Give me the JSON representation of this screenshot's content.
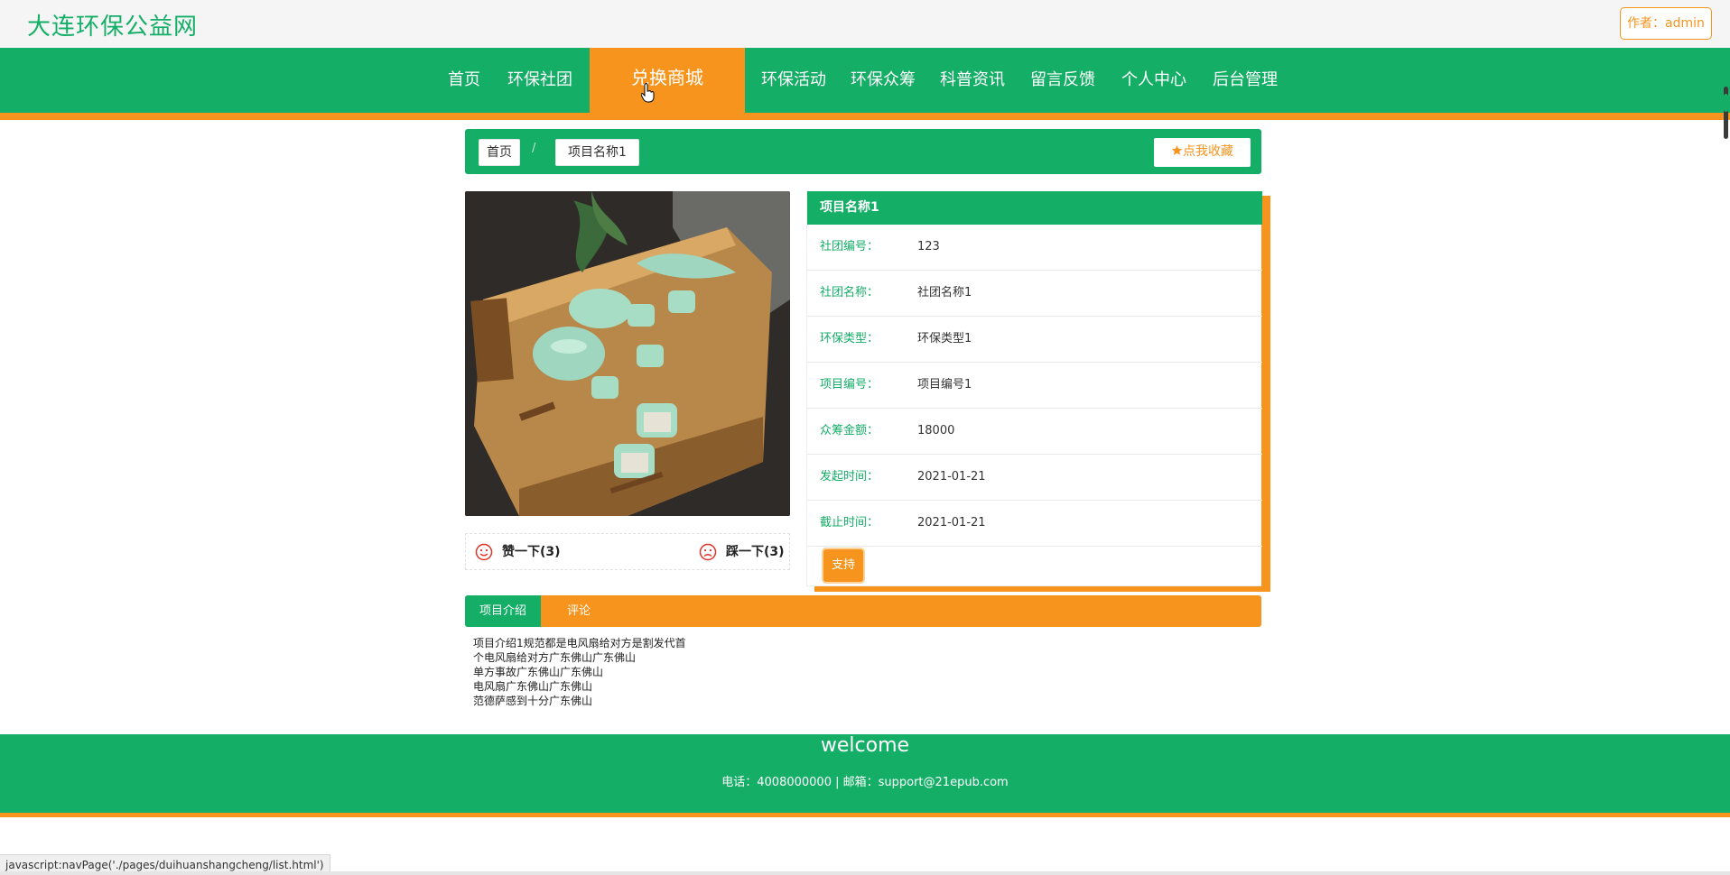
{
  "header": {
    "site_title": "大连环保公益网",
    "author_label": "作者：admin"
  },
  "nav": {
    "items": [
      "首页",
      "环保社团",
      "兑换商城",
      "环保活动",
      "环保众筹",
      "科普资讯",
      "留言反馈",
      "个人中心",
      "后台管理"
    ],
    "active": "兑换商城"
  },
  "breadcrumb": {
    "home": "首页",
    "separator": "/",
    "current": "项目名称1",
    "favorite_label": "点我收藏"
  },
  "votes": {
    "like_label": "赞一下(3)",
    "dislike_label": "踩一下(3)"
  },
  "detail": {
    "title": "项目名称1",
    "fields": [
      {
        "label": "社团编号：",
        "value": "123"
      },
      {
        "label": "社团名称：",
        "value": "社团名称1"
      },
      {
        "label": "环保类型：",
        "value": "环保类型1"
      },
      {
        "label": "项目编号：",
        "value": "项目编号1"
      },
      {
        "label": "众筹金额：",
        "value": "18000"
      },
      {
        "label": "发起时间：",
        "value": "2021-01-21"
      },
      {
        "label": "截止时间：",
        "value": "2021-01-21"
      }
    ],
    "support_label": "支持"
  },
  "tabs": {
    "items": [
      "项目介绍",
      "评论"
    ],
    "active": "项目介绍"
  },
  "intro": {
    "lines": [
      "项目介绍1规范都是电风扇给对方是割发代首",
      "个电风扇给对方广东佛山广东佛山",
      "单方事故广东佛山广东佛山",
      "电风扇广东佛山广东佛山",
      "范德萨感到十分广东佛山"
    ]
  },
  "footer": {
    "welcome": "welcome",
    "contact": "电话：4008000000 | 邮箱：support@21epub.com"
  },
  "statusbar": {
    "text": "javascript:navPage('./pages/duihuanshangcheng/list.html')"
  },
  "colors": {
    "primary_green": "#14ae67",
    "accent_orange": "#f7941d"
  }
}
